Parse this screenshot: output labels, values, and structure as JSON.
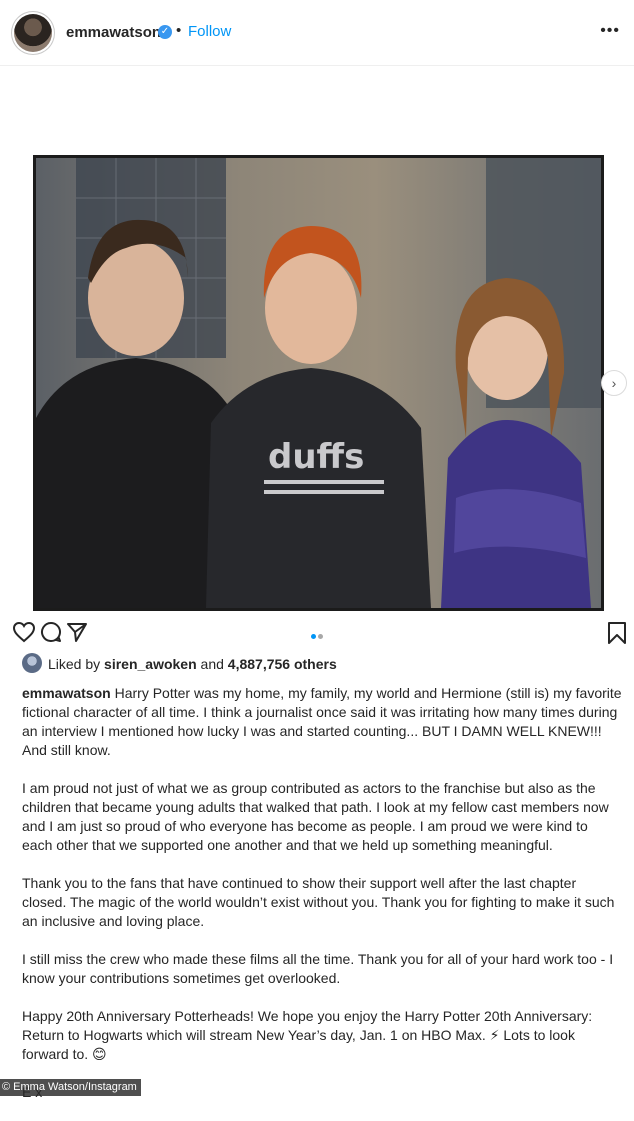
{
  "header": {
    "username": "emmawatson",
    "separator": "•",
    "follow_label": "Follow",
    "more_icon": "•••"
  },
  "media": {
    "photo_description_icon": "photo",
    "shirt_text": "duffs",
    "next_icon": "›"
  },
  "actions": {
    "like_icon": "heart-icon",
    "comment_icon": "comment-icon",
    "share_icon": "share-icon",
    "save_icon": "bookmark-icon"
  },
  "likes": {
    "prefix": "Liked by",
    "user": "siren_awoken",
    "middle": "and",
    "count": "4,887,756 others"
  },
  "caption": {
    "username": "emmawatson",
    "paragraphs": [
      "Harry Potter was my home, my family, my world and Hermione (still is) my favorite fictional character of all time. I think a journalist once said it was irritating how many times during an interview I mentioned how lucky I was and started counting... BUT I DAMN WELL KNEW!!! And still know.",
      "I am proud not just of what we as group contributed as actors to the franchise but also as the children that became young adults that walked that path. I look at my fellow cast members now and I am just so proud of who everyone has become as people. I am proud we were kind to each other that we supported one another and that we held up something meaningful.",
      "Thank you to the fans that have continued to show their support well after the last chapter closed. The magic of the world wouldn’t exist without you. Thank you for fighting to make it such an inclusive and loving place.",
      "I still miss the crew who made these films all the time. Thank you for all of your hard work too - I know your contributions sometimes get overlooked.",
      "Happy 20th Anniversary Potterheads! We hope you enjoy the Harry Potter 20th Anniversary: Return to Hogwarts which will stream New Year’s day, Jan. 1 on HBO Max. ⚡ Lots to look forward to. 😊",
      "E x"
    ]
  },
  "credit": "© Emma Watson/Instagram",
  "colors": {
    "link_blue": "#0095f6",
    "verified_blue": "#3897f0",
    "text": "#262626"
  }
}
